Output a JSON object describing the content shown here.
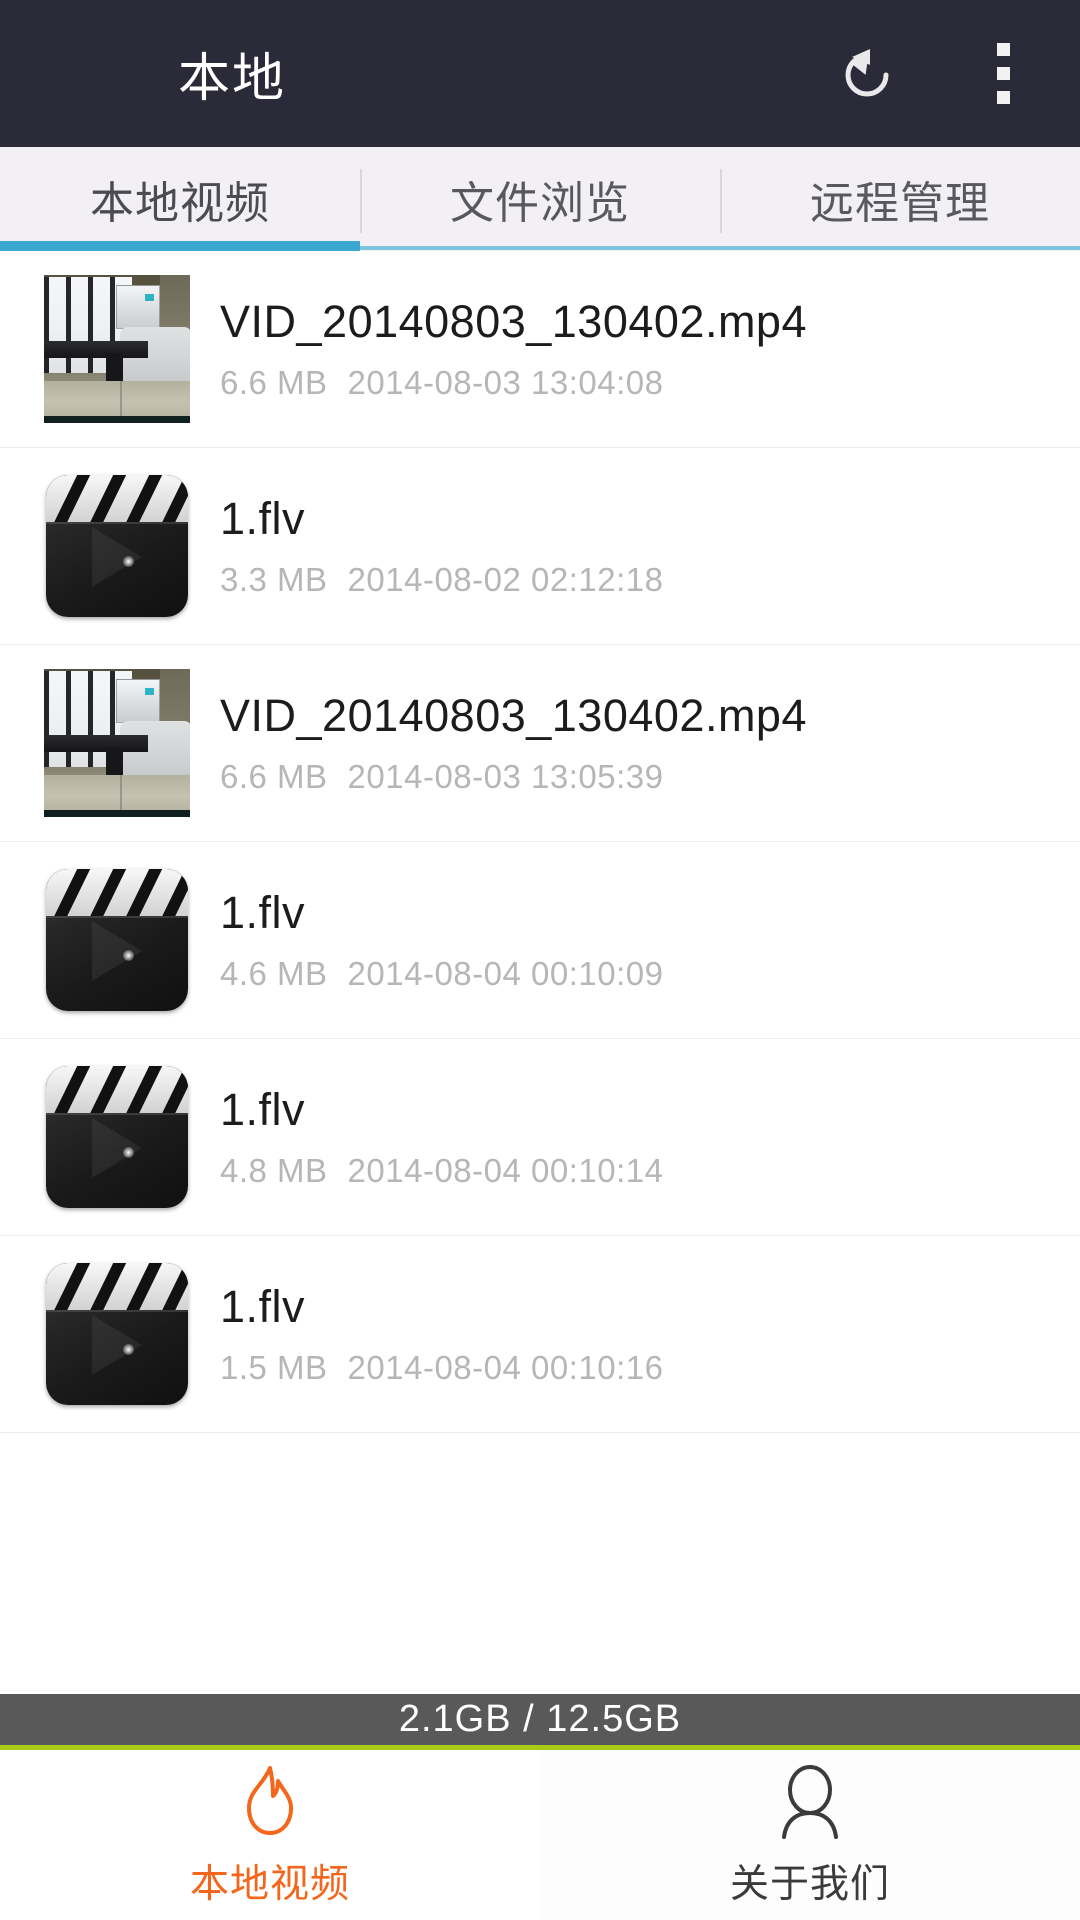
{
  "header": {
    "title": "本地",
    "refresh_icon": "refresh-rotate-icon",
    "overflow_icon": "overflow-menu-icon",
    "background_color": "#2b2a38"
  },
  "tabs": {
    "active_index": 0,
    "accent_color": "#3ba8cf",
    "items": [
      {
        "label": "本地视频"
      },
      {
        "label": "文件浏览"
      },
      {
        "label": "远程管理"
      }
    ]
  },
  "file_list": [
    {
      "name": "VID_20140803_130402.mp4",
      "size": "6.6 MB",
      "date": "2014-08-03 13:04:08",
      "thumb": "photo"
    },
    {
      "name": "1.flv",
      "size": "3.3 MB",
      "date": "2014-08-02 02:12:18",
      "thumb": "clapper"
    },
    {
      "name": "VID_20140803_130402.mp4",
      "size": "6.6 MB",
      "date": "2014-08-03 13:05:39",
      "thumb": "photo"
    },
    {
      "name": "1.flv",
      "size": "4.6 MB",
      "date": "2014-08-04 00:10:09",
      "thumb": "clapper"
    },
    {
      "name": "1.flv",
      "size": "4.8 MB",
      "date": "2014-08-04 00:10:14",
      "thumb": "clapper"
    },
    {
      "name": "1.flv",
      "size": "1.5 MB",
      "date": "2014-08-04 00:10:16",
      "thumb": "clapper"
    }
  ],
  "storage": {
    "text": "2.1GB / 12.5GB",
    "used": "2.1GB",
    "total": "12.5GB",
    "bar_color": "#59595a",
    "accent_color": "#aacc19"
  },
  "bottom_nav": {
    "selected_index": 0,
    "selected_color": "#f4661b",
    "items": [
      {
        "label": "本地视频",
        "icon": "flame-icon"
      },
      {
        "label": "关于我们",
        "icon": "person-icon"
      }
    ]
  }
}
